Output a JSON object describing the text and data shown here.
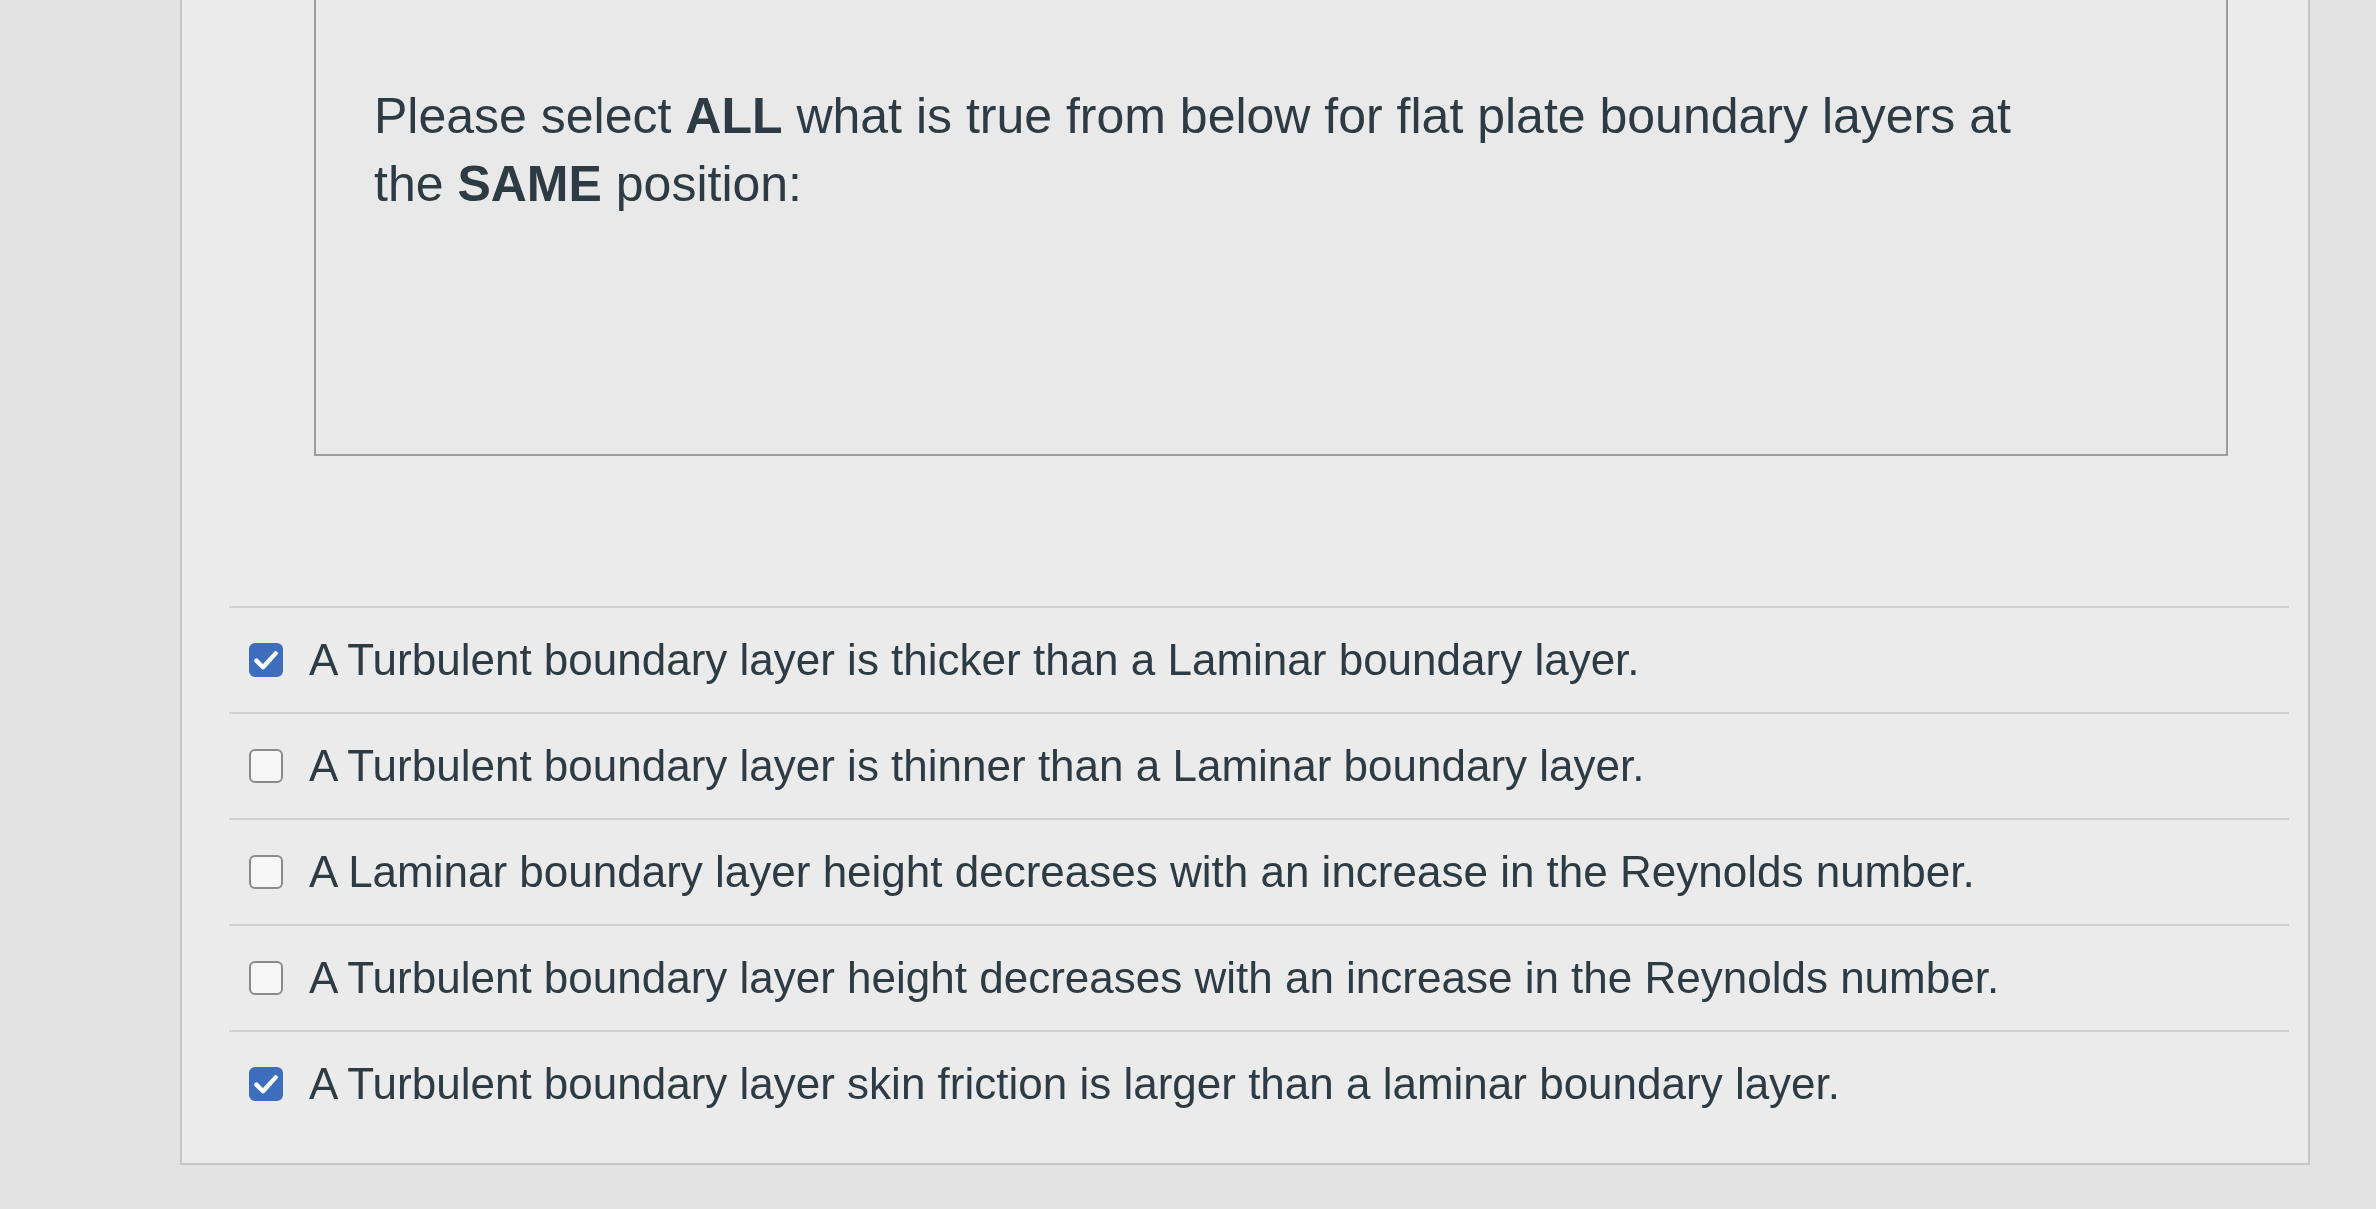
{
  "question": {
    "text": "Please select **ALL** what is true from below for flat plate boundary layers at the **SAME** position:"
  },
  "options": [
    {
      "label": "A Turbulent boundary layer is thicker than a Laminar boundary layer.",
      "checked": true
    },
    {
      "label": "A Turbulent boundary layer is thinner than a Laminar boundary layer.",
      "checked": false
    },
    {
      "label": "A Laminar boundary layer height decreases with an increase in the Reynolds number.",
      "checked": false
    },
    {
      "label": "A Turbulent boundary layer height decreases with an increase in the Reynolds number.",
      "checked": false
    },
    {
      "label": "A Turbulent boundary layer skin friction is larger than a laminar boundary layer.",
      "checked": true
    }
  ]
}
